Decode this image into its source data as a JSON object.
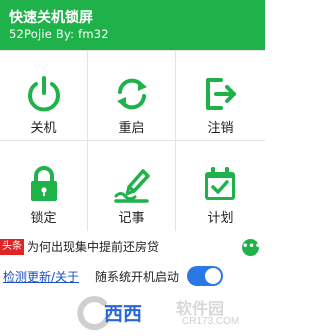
{
  "header": {
    "title": "快速关机锁屏",
    "subtitle": "52Pojie By:  fm32"
  },
  "actions": [
    {
      "label": "关机",
      "icon": "power-icon"
    },
    {
      "label": "重启",
      "icon": "restart-icon"
    },
    {
      "label": "注销",
      "icon": "logout-icon"
    },
    {
      "label": "锁定",
      "icon": "lock-icon"
    },
    {
      "label": "记事",
      "icon": "note-icon"
    },
    {
      "label": "计划",
      "icon": "calendar-check-icon"
    }
  ],
  "news": {
    "tag": "头条",
    "text": "为何出现集中提前还房贷",
    "more_icon": "more-dots-icon"
  },
  "footer": {
    "update_link": "检测更新/关于",
    "autostart_label": "随系统开机启动",
    "autostart_on": true
  },
  "watermark": {
    "text1": "西西",
    "text2": "软件园",
    "text3": "CR173.COM"
  },
  "colors": {
    "brand_green": "#1fb24a",
    "toggle_blue": "#2a78e4",
    "tag_red": "#e02424",
    "link_blue": "#1a4fc4"
  }
}
